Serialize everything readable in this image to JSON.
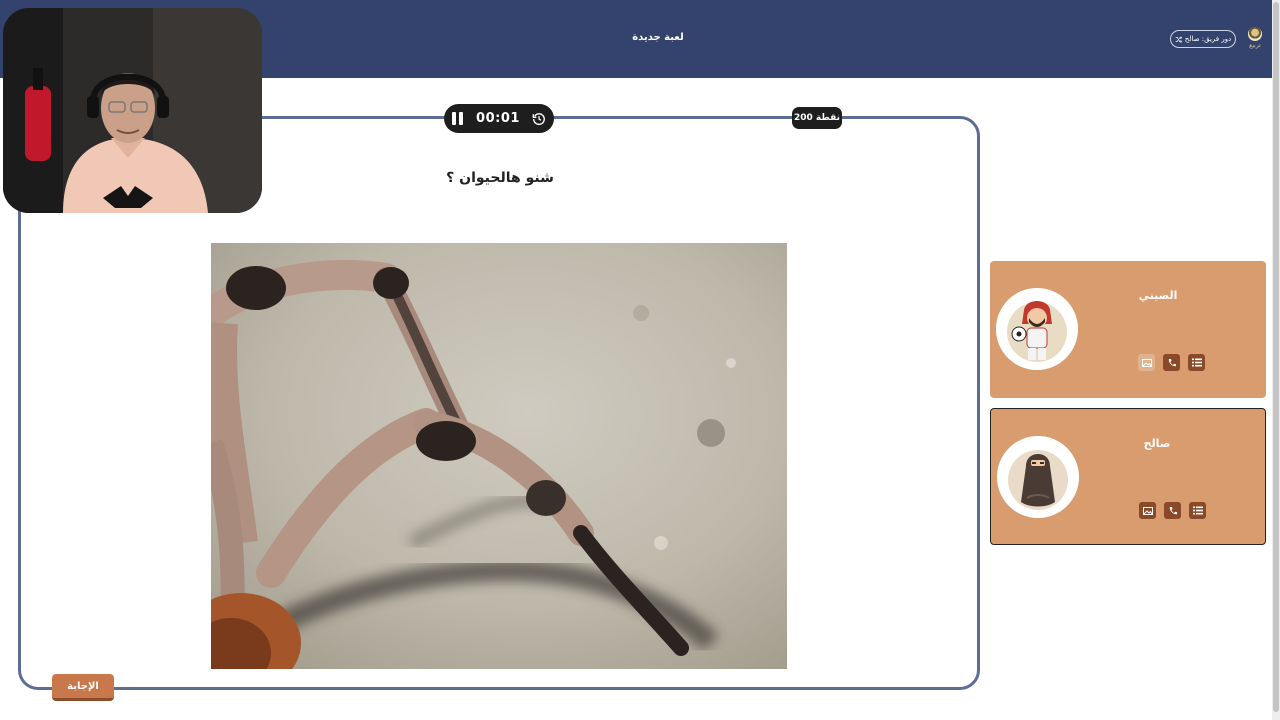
{
  "topbar": {
    "game_title": "لعبة جديدة",
    "turn_label": "دور فريق: صالح",
    "logo_text": "تربيع"
  },
  "question": {
    "timer": "00:01",
    "points": "200 نقطة",
    "text": "شنو هالحيوان ؟",
    "answer_label": "الإجابة"
  },
  "teams": [
    {
      "name": "الصيني",
      "avatar": "footballer-avatar",
      "active": false,
      "tools_enabled": [
        false,
        true,
        true
      ]
    },
    {
      "name": "صالح",
      "avatar": "veiled-woman-avatar",
      "active": true,
      "tools_enabled": [
        true,
        true,
        true
      ]
    }
  ],
  "icons": {
    "pause": "pause-icon",
    "reset": "restart-timer-icon",
    "shuffle": "shuffle-icon",
    "tools": [
      "double-image-icon",
      "phone-icon",
      "list-icon"
    ]
  },
  "colors": {
    "topbar": "#34426e",
    "card_border": "#5d6d94",
    "team_card": "#d99c6e",
    "tool_button": "#8a4a2a",
    "answer_button": "#c8784a"
  }
}
